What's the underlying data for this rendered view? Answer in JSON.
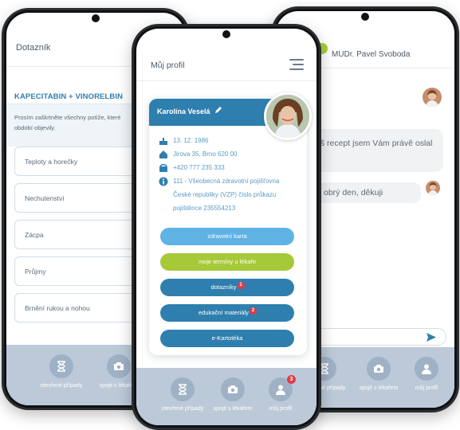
{
  "colors": {
    "primary_blue": "#2f7fae",
    "light_blue": "#5eb3e4",
    "lime": "#a6c93a",
    "nav_bg": "#bcc9d8",
    "badge_red": "#e23b46"
  },
  "left": {
    "title": "Dotazník",
    "section_title": "KAPECITABIN + VINORELBIN",
    "instruction": "Prosím zaškrtněte všechny potíže, které",
    "instruction2": "období objevily.",
    "symptoms": [
      "Teploty a horečky",
      "Nechutenství",
      "Zácpa",
      "Průjmy",
      "Brnění rukou a nohou"
    ],
    "nav": [
      "otevřené případy",
      "spojit s lékařem"
    ]
  },
  "center": {
    "title": "Můj profil",
    "name": "Karolína Veselá",
    "dob": "13. 12. 1986",
    "address": "Jirova 35, Brno 620 00",
    "phone": "+420 777 235 333",
    "insurance_line1": "111 - Všeobecná zdravotní pojišťovna",
    "insurance_line2": "České republiky (VZP) číslo průkazu",
    "insurance_line3": "pojištěnce 235554213",
    "buttons": {
      "card": "zdravotní karta",
      "appointments": "moje termíny u lékaře",
      "questionnaires": "dotazníky",
      "questionnaires_badge": "1",
      "materials": "edukační materiály",
      "materials_badge": "2",
      "ekartoteka": "e-Kartotéka"
    },
    "nav": [
      "otevřené případy",
      "spojit s lékařem",
      "můj profil"
    ],
    "nav_badge": "3"
  },
  "right": {
    "doctor": "MUDr. Pavel Svoboda",
    "msg1": "áš recept jsem Vám právě oslal",
    "msg2": "obrý den, děkuji",
    "nav": [
      "otevřené případy",
      "spojit s lékařem",
      "můj profil"
    ]
  }
}
